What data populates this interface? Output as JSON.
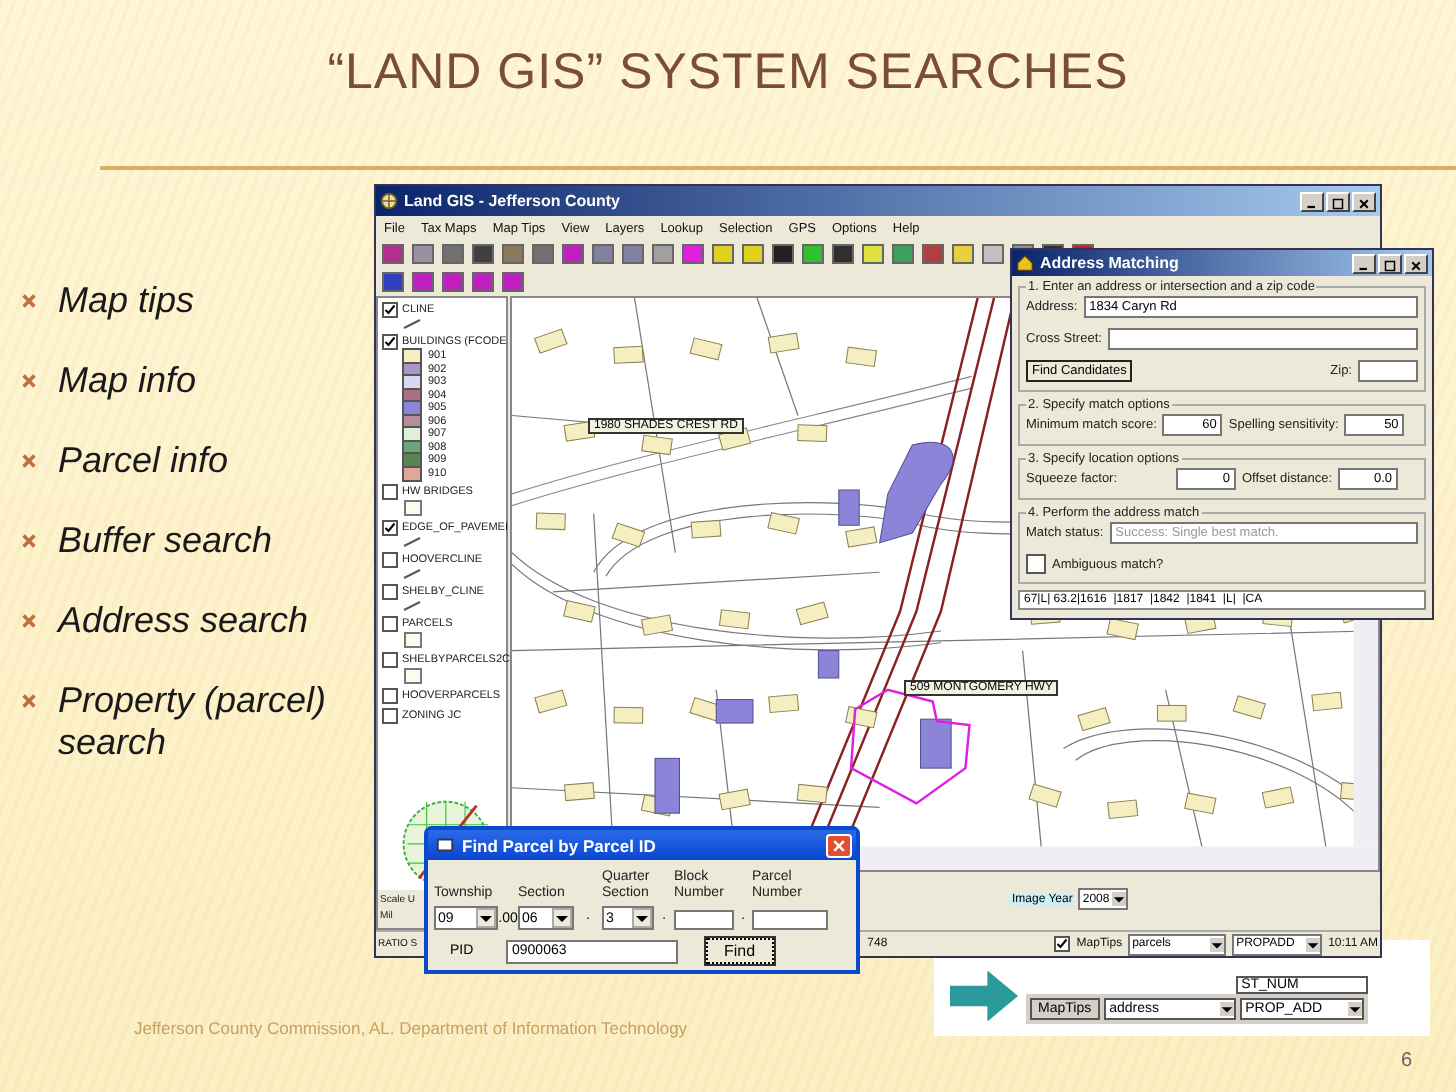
{
  "slide": {
    "title": "“LAND GIS” SYSTEM SEARCHES",
    "bullets": [
      "Map tips",
      "Map info",
      "Parcel info",
      "Buffer search",
      "Address search",
      "Property (parcel) search"
    ],
    "footer": "Jefferson County Commission, AL. Department of Information Technology",
    "page_number": "6"
  },
  "gis_window": {
    "title": "Land GIS - Jefferson County",
    "menu": [
      "File",
      "Tax Maps",
      "Map Tips",
      "View",
      "Layers",
      "Lookup",
      "Selection",
      "GPS",
      "Options",
      "Help"
    ],
    "layers": [
      {
        "name": "CLINE",
        "checked": true,
        "kind": "line"
      },
      {
        "name": "BUILDINGS (FCODE",
        "checked": true,
        "kind": "classes",
        "classes": [
          {
            "label": "901",
            "color": "#f4eec0"
          },
          {
            "label": "902",
            "color": "#a898c8"
          },
          {
            "label": "903",
            "color": "#d8d8f0"
          },
          {
            "label": "904",
            "color": "#a87080"
          },
          {
            "label": "905",
            "color": "#8c84d8"
          },
          {
            "label": "906",
            "color": "#b88c98"
          },
          {
            "label": "907",
            "color": "#e0f0d8"
          },
          {
            "label": "908",
            "color": "#6ca47c"
          },
          {
            "label": "909",
            "color": "#5c8450"
          },
          {
            "label": "910",
            "color": "#e0a898"
          }
        ]
      },
      {
        "name": "HW BRIDGES",
        "checked": false,
        "kind": "box"
      },
      {
        "name": "EDGE_OF_PAVEMEI",
        "checked": true,
        "kind": "line"
      },
      {
        "name": "HOOVERCLINE",
        "checked": false,
        "kind": "line"
      },
      {
        "name": "SHELBY_CLINE",
        "checked": false,
        "kind": "line"
      },
      {
        "name": "PARCELS",
        "checked": false,
        "kind": "box"
      },
      {
        "name": "SHELBYPARCELS2C",
        "checked": false,
        "kind": "box"
      },
      {
        "name": "HOOVERPARCELS",
        "checked": false,
        "kind": "none"
      },
      {
        "name": "ZONING JC",
        "checked": false,
        "kind": "none"
      }
    ],
    "map_labels": [
      "1980 SHADES CREST RD",
      "509 MONTGOMERY HWY"
    ],
    "scale_labels": [
      "Scale U",
      "Mil"
    ],
    "image_year": {
      "label": "Image Year",
      "value": "2008"
    },
    "status_bar": {
      "ratio": "RATIO S",
      "coordinate": "748",
      "maptips": {
        "label": "MapTips",
        "checked": true
      },
      "layer_select": "parcels",
      "field_select": "PROPADD",
      "time": "10:11 AM"
    }
  },
  "address_dialog": {
    "title": "Address Matching",
    "group_1": "1.  Enter an address or intersection and a zip code",
    "address": {
      "label": "Address:",
      "value": "1834 Caryn Rd"
    },
    "cross_street": {
      "label": "Cross Street:"
    },
    "find_button": "Find Candidates",
    "zip": {
      "label": "Zip:"
    },
    "group_2": "2.  Specify match options",
    "min_score": {
      "label": "Minimum match score:",
      "value": "60"
    },
    "spelling": {
      "label": "Spelling sensitivity:",
      "value": "50"
    },
    "group_3": "3.  Specify location options",
    "squeeze": {
      "label": "Squeeze factor:",
      "value": "0"
    },
    "offset": {
      "label": "Offset distance:",
      "value": "0.0"
    },
    "group_4": "4.  Perform the address match",
    "status": {
      "label": "Match status:",
      "value": "Success: Single best match."
    },
    "ambiguous": {
      "label": "Ambiguous match?",
      "checked": false
    },
    "result_row": "67|L| 63.2|1616  |1817  |1842  |1841  |L|  |CA"
  },
  "parcel_dialog": {
    "title": "Find Parcel by Parcel ID",
    "fields": [
      {
        "label": "Township",
        "kind": "select",
        "value": "09"
      },
      {
        "label": "Section",
        "kind": "select",
        "value": "06",
        "prefix": ".00"
      },
      {
        "label": "Quarter Section",
        "kind": "select",
        "value": "3",
        "prefix": "·"
      },
      {
        "label": "Block Number",
        "kind": "text",
        "prefix": "·"
      },
      {
        "label": "Parcel Number",
        "kind": "text",
        "prefix": "·"
      }
    ],
    "pid": {
      "label": "PID",
      "value": "0900063"
    },
    "find_button": "Find"
  },
  "inset": {
    "list_item": "ST_NUM",
    "button": "MapTips",
    "layer_select": "address",
    "field_select": "PROP_ADD"
  }
}
